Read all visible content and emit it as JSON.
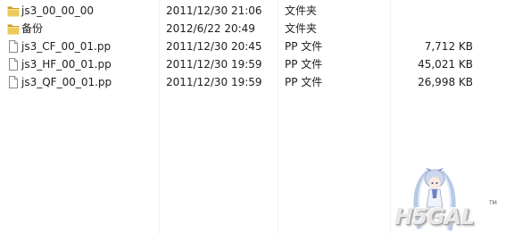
{
  "files": [
    {
      "icon": "folder-icon",
      "name": "js3_00_00_00",
      "date": "2011/12/30 21:06",
      "type": "文件夹",
      "size": ""
    },
    {
      "icon": "folder-icon",
      "name": "备份",
      "date": "2012/6/22 20:49",
      "type": "文件夹",
      "size": ""
    },
    {
      "icon": "file-icon",
      "name": "js3_CF_00_01.pp",
      "date": "2011/12/30 20:45",
      "type": "PP 文件",
      "size": "7,712 KB"
    },
    {
      "icon": "file-icon",
      "name": "js3_HF_00_01.pp",
      "date": "2011/12/30 19:59",
      "type": "PP 文件",
      "size": "45,021 KB"
    },
    {
      "icon": "file-icon",
      "name": "js3_QF_00_01.pp",
      "date": "2011/12/30 19:59",
      "type": "PP 文件",
      "size": "26,998 KB"
    }
  ],
  "watermark": {
    "logo_text": "H5GAL",
    "trademark": "TM"
  },
  "colors": {
    "folder": "#e8c04a",
    "folder_dark": "#c89a20",
    "column_separator": "#f2f2f2"
  }
}
